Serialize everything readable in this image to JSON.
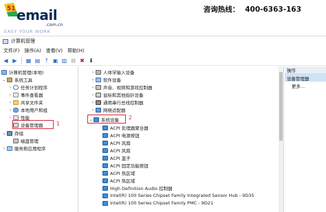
{
  "banner": {
    "logo_text": "email",
    "logo_digits": "51",
    "logo_domain": ".com.cn",
    "slogan": "EASY YOUR WORK",
    "hotline_label": "咨询热线：",
    "hotline_number": "400-6363-163"
  },
  "window": {
    "title": "计算机管理",
    "menu": [
      "文件(F)",
      "操作(A)",
      "查看(V)",
      "帮助(H)"
    ]
  },
  "left_tree": {
    "root": "计算机管理(本地)",
    "system_tools": "系统工具",
    "task_scheduler": "任务计划程序",
    "event_viewer": "事件查看器",
    "shared_folders": "共享文件夹",
    "local_users": "本地用户和组",
    "performance": "性能",
    "device_manager": "设备管理器",
    "storage": "存储",
    "disk_management": "磁盘管理",
    "services": "服务和应用程序"
  },
  "device_tree": {
    "collapsed": [
      "人体学输入设备",
      "软件设备",
      "声音、视频和游戏控制器",
      "鼠标和其他指针设备",
      "通用串行总线控制器",
      "网络适配器"
    ],
    "expanded": "系统设备",
    "children": [
      "ACPI 处理器聚合器",
      "ACPI 电源按钮",
      "ACPI 风扇",
      "ACPI 风扇",
      "ACPI 盖子",
      "ACPI 固定功能按钮",
      "ACPI 热区域",
      "ACPI 热区域",
      "High Definition Audio 控制器",
      "Intel(R) 100 Series Chipset Family Integrated Sensor Hub - 9D35",
      "Intel(R) 100 Series Chipset Family PMC - 9D21"
    ]
  },
  "callouts": {
    "one": "1",
    "two": "2"
  },
  "actions": {
    "header": "操作",
    "selected": "设备管理器",
    "more": "更多..."
  }
}
